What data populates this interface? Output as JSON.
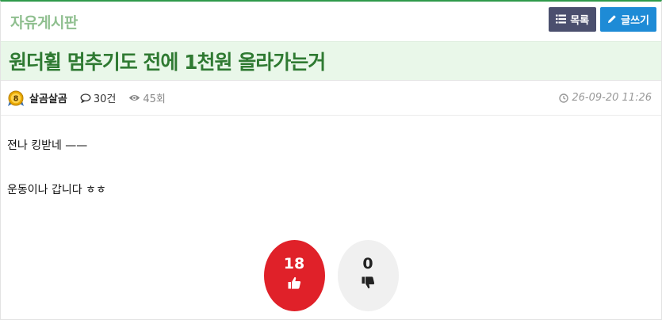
{
  "board": {
    "name": "자유게시판",
    "buttons": {
      "list_label": "목록",
      "write_label": "글쓰기"
    }
  },
  "post": {
    "title": "원더휠 멈추기도 전에 1천원 올라가는거",
    "author": {
      "name": "살곰살곰",
      "level": "8"
    },
    "comments": "30건",
    "views": "45회",
    "datetime": "26-09-20 11:26",
    "content": {
      "line1": "젼나 킹받네 ——",
      "line2": "운동이나 갑니다 ㅎㅎ"
    }
  },
  "votes": {
    "up": "18",
    "down": "0"
  },
  "colors": {
    "accent_green": "#2e9a4a",
    "title_green": "#2f7a32",
    "list_button": "#4b4f6e",
    "write_button": "#1e8bd6",
    "vote_up": "#e02129"
  },
  "icons": {
    "list": "list-icon",
    "write": "pencil-icon",
    "comment": "comment-icon",
    "views": "eye-icon",
    "time": "clock-icon",
    "up": "thumbs-up-icon",
    "down": "thumbs-down-icon"
  }
}
